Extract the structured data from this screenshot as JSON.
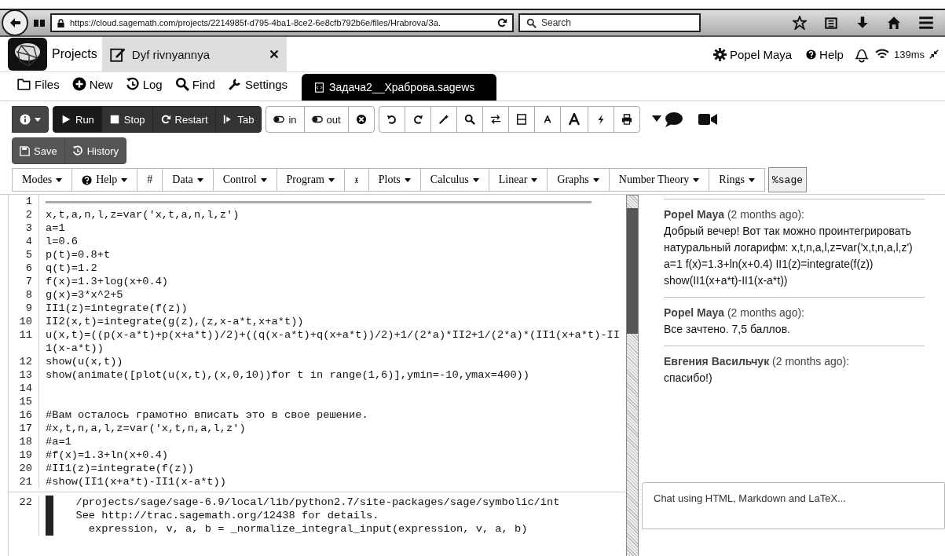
{
  "browser": {
    "url": "https://cloud.sagemath.com/projects/2214985f-d795-4ba1-8ce2-6e8cfb792b6e/files/Hrabrova/За.",
    "search_placeholder": "Search"
  },
  "header": {
    "projects": "Projects",
    "project_tab": "Dyf rivnyannya",
    "user": "Popel Maya",
    "help": "Help",
    "ping": "139ms"
  },
  "file_nav": [
    {
      "kind": "folder",
      "label": "Files"
    },
    {
      "kind": "plus",
      "label": "New"
    },
    {
      "kind": "history",
      "label": "Log"
    },
    {
      "kind": "search",
      "label": "Find"
    },
    {
      "kind": "wrench",
      "label": "Settings"
    }
  ],
  "file_tab": {
    "label": "Задача2__Храброва.sagews",
    "selected": true
  },
  "toolbar": [
    {
      "buttons": [
        {
          "kind": "info"
        }
      ]
    },
    {
      "buttons": [
        {
          "kind": "play",
          "label": "Run"
        },
        {
          "kind": "stop",
          "label": "Stop"
        },
        {
          "kind": "refresh",
          "label": "Restart"
        },
        {
          "kind": "tab",
          "label": "Tab"
        }
      ]
    },
    {
      "buttons": [
        {
          "kind": "toggle",
          "label": "in"
        },
        {
          "kind": "toggle",
          "label": "out"
        },
        {
          "kind": "xcircle"
        }
      ]
    },
    {
      "buttons": [
        {
          "kind": "undo"
        },
        {
          "kind": "redo"
        },
        {
          "kind": "wand"
        },
        {
          "kind": "search"
        },
        {
          "kind": "swap"
        },
        {
          "kind": "split"
        },
        {
          "kind": "font-small"
        },
        {
          "kind": "font-large"
        },
        {
          "kind": "bolt"
        },
        {
          "kind": "print"
        }
      ]
    },
    {
      "buttons": [
        {
          "kind": "chat"
        },
        {
          "kind": "video"
        }
      ]
    }
  ],
  "toolbar2": [
    {
      "kind": "save",
      "label": "Save"
    },
    {
      "kind": "history",
      "label": "History"
    }
  ],
  "menus": [
    {
      "label": "Modes",
      "kind": "dropdown"
    },
    {
      "label": "Help",
      "kind": "help"
    },
    {
      "label": "#",
      "kind": "plain"
    },
    {
      "label": "Data",
      "kind": "dropdown"
    },
    {
      "label": "Control",
      "kind": "dropdown"
    },
    {
      "label": "Program",
      "kind": "dropdown"
    },
    {
      "label": "𝔵",
      "kind": "plain"
    },
    {
      "label": "Plots",
      "kind": "dropdown"
    },
    {
      "label": "Calculus",
      "kind": "dropdown"
    },
    {
      "label": "Linear",
      "kind": "dropdown"
    },
    {
      "label": "Graphs",
      "kind": "dropdown"
    },
    {
      "label": "Number Theory",
      "kind": "dropdown"
    },
    {
      "label": "Rings",
      "kind": "dropdown"
    }
  ],
  "mode": "%sage",
  "code_lines": [
    {
      "n": "1",
      "kind": "input-marker"
    },
    {
      "n": "2",
      "text": "x,t,a,n,l,z=var('x,t,a,n,l,z')",
      "kind": "code"
    },
    {
      "n": "3",
      "text": "a=1",
      "kind": "code"
    },
    {
      "n": "4",
      "text": "l=0.6",
      "kind": "code"
    },
    {
      "n": "5",
      "text": "p(t)=0.8+t",
      "kind": "code"
    },
    {
      "n": "6",
      "text": "q(t)=1.2",
      "kind": "code"
    },
    {
      "n": "7",
      "text": "f(x)=1.3+log(x+0.4)",
      "kind": "code"
    },
    {
      "n": "8",
      "text": "g(x)=3*x^2+5",
      "kind": "code"
    },
    {
      "n": "9",
      "text": "II1(z)=integrate(f(z))",
      "kind": "code"
    },
    {
      "n": "10",
      "text": "II2(x,t)=integrate(g(z),(z,x-a*t,x+a*t))",
      "kind": "code"
    },
    {
      "n": "11",
      "text": "u(x,t)=((p(x-a*t)+p(x+a*t))/2)+((q(x-a*t)+q(x+a*t))/2)+1/(2*a)*II2+1/(2*a)*(II1(x+a*t)-II1(x-a*t))",
      "kind": "code"
    },
    {
      "n": "12",
      "text": "show(u(x,t))",
      "kind": "code"
    },
    {
      "n": "13",
      "text": "show(animate([plot(u(x,t),(x,0,10))for t in range(1,6)],ymin=-10,ymax=400))",
      "kind": "code"
    },
    {
      "n": "14",
      "kind": "code"
    },
    {
      "n": "15",
      "kind": "code"
    },
    {
      "n": "16",
      "text": "#Вам осталось грамотно вписать это в свое решение.",
      "kind": "code"
    },
    {
      "n": "17",
      "text": "#x,t,n,a,l,z=var('x,t,n,a,l,z')",
      "kind": "code"
    },
    {
      "n": "18",
      "text": "#a=1",
      "kind": "code"
    },
    {
      "n": "19",
      "text": "#f(x)=1.3+ln(x+0.4)",
      "kind": "code"
    },
    {
      "n": "20",
      "text": "#II1(z)=integrate(f(z))",
      "kind": "code"
    },
    {
      "n": "21",
      "text": "#show(II1(x+a*t)-II1(x-a*t))",
      "kind": "code"
    },
    {
      "n": "22",
      "kind": "output",
      "output": [
        "  /projects/sage/sage-6.9/local/lib/python2.7/site-packages/sage/symbolic/int",
        "  See http://trac.sagemath.org/12438 for details.",
        "    expression, v, a, b = _normalize_integral_input(expression, v, a, b)"
      ]
    }
  ],
  "chat": {
    "messages": [
      {
        "header": "**Popel Maya** (2 months ago):",
        "text": "Добрый вечер! Вот так можно проинтегрировать натуральный логарифм: x,t,n,a,l,z=var('x,t,n,a,l,z') a=1 f(x)=1.3+ln(x+0.4) II1(z)=integrate(f(z)) show(II1(x+a*t)-II1(x-a*t))"
      },
      {
        "header": "**Popel Maya** (2 months ago):",
        "text": "Все зачтено. 7,5 баллов."
      },
      {
        "header": "**Евгения Васильчук** (2 months ago):",
        "text": "спасибо!)"
      }
    ],
    "placeholder": "Chat using HTML, Markdown and LaTeX..."
  }
}
